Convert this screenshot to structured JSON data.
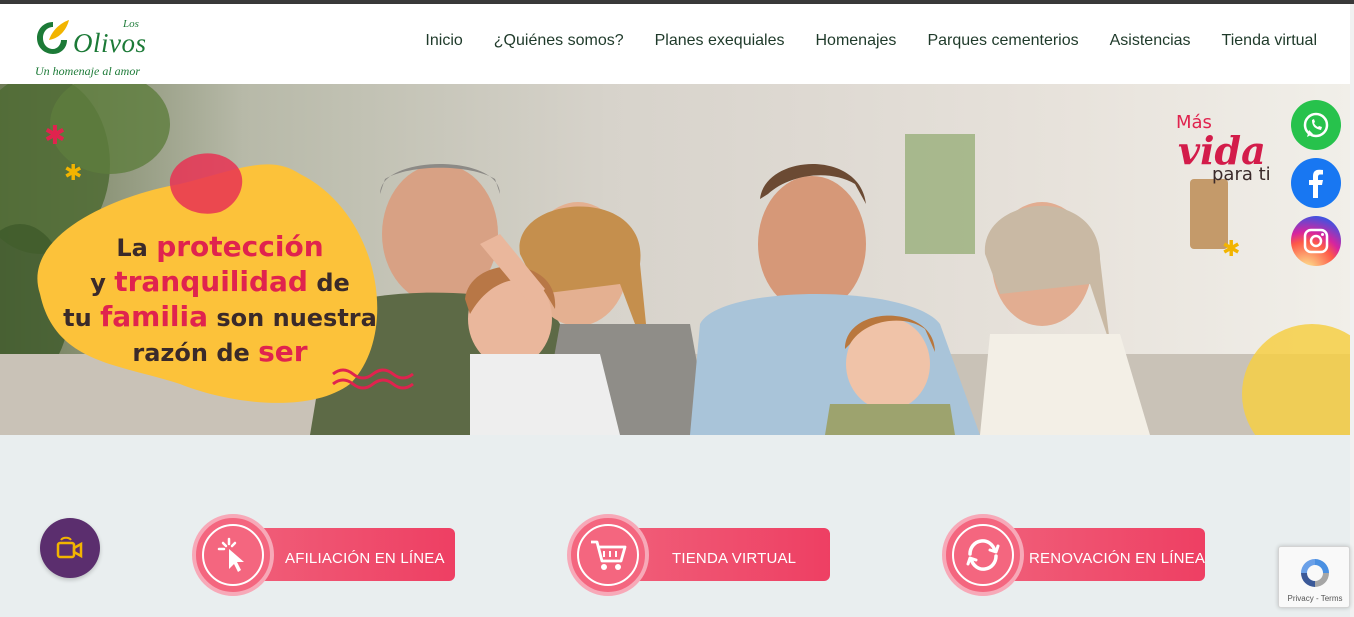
{
  "brand": {
    "logo_small": "Los",
    "logo_name": "Olivos",
    "tagline": "Un homenaje al amor"
  },
  "nav": {
    "items": [
      {
        "label": "Inicio"
      },
      {
        "label": "¿Quiénes somos?"
      },
      {
        "label": "Planes exequiales"
      },
      {
        "label": "Homenajes"
      },
      {
        "label": "Parques cementerios"
      },
      {
        "label": "Asistencias"
      },
      {
        "label": "Tienda virtual"
      }
    ]
  },
  "hero": {
    "line1_a": "La ",
    "line1_b": "protección",
    "line2_a": "y ",
    "line2_b": "tranquilidad",
    "line2_c": " de",
    "line3_a": "tu ",
    "line3_b": "familia",
    "line3_c": " son nuestra",
    "line4_a": "razón de ",
    "line4_b": "ser",
    "slogan_top": "Más",
    "slogan_mid": "vida",
    "slogan_bottom": "para ti"
  },
  "social": {
    "whatsapp": "whatsapp-icon",
    "facebook": "facebook-icon",
    "instagram": "instagram-icon"
  },
  "actions": {
    "video": "video-call-icon",
    "afiliacion": "AFILIACIÓN EN LÍNEA",
    "tienda": "TIENDA VIRTUAL",
    "renovacion": "RENOVACIÓN EN LÍNEA"
  },
  "recaptcha": {
    "text": "Privacy - Terms"
  },
  "colors": {
    "accent": "#ee3f63",
    "brand_green": "#1c7a37",
    "video_purple": "#5b2e6e"
  }
}
